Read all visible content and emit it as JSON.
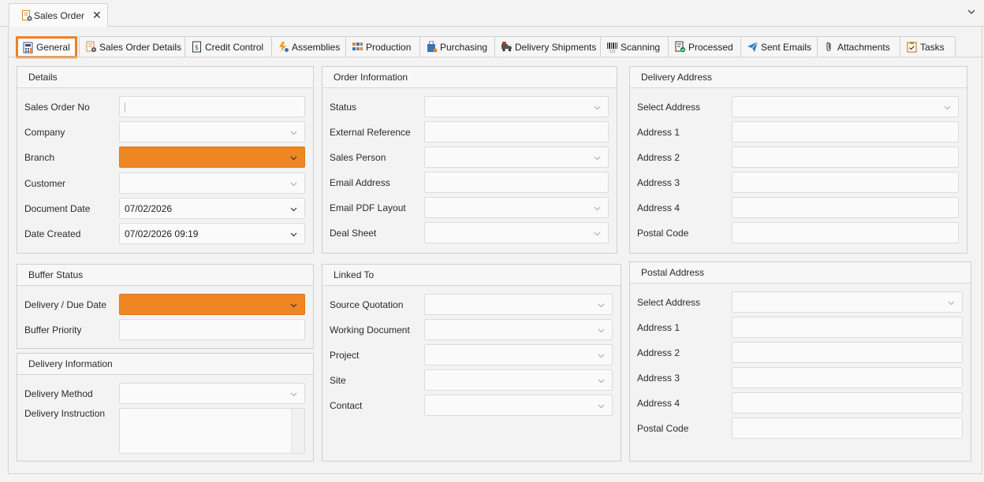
{
  "doc_tab": {
    "title": "Sales Order",
    "close": "✕"
  },
  "tabs": [
    {
      "label": "General",
      "icon": "calculator-icon"
    },
    {
      "label": "Sales Order Details",
      "icon": "document-gear-icon"
    },
    {
      "label": "Credit Control",
      "icon": "dollar-document-icon"
    },
    {
      "label": "Assemblies",
      "icon": "lightning-gear-icon"
    },
    {
      "label": "Production",
      "icon": "blocks-icon"
    },
    {
      "label": "Purchasing",
      "icon": "shopping-bag-icon"
    },
    {
      "label": "Delivery Shipments",
      "icon": "delivery-truck-icon"
    },
    {
      "label": "Scanning",
      "icon": "barcode-icon"
    },
    {
      "label": "Processed",
      "icon": "document-check-icon"
    },
    {
      "label": "Sent Emails",
      "icon": "paper-plane-icon"
    },
    {
      "label": "Attachments",
      "icon": "paperclip-icon"
    },
    {
      "label": "Tasks",
      "icon": "clipboard-check-icon"
    }
  ],
  "details": {
    "header": "Details",
    "labels": [
      "Sales Order No",
      "Company",
      "Branch",
      "Customer",
      "Document Date",
      "Date Created"
    ],
    "document_date": "07/02/2026",
    "date_created": "07/02/2026 09:19"
  },
  "order_info": {
    "header": "Order Information",
    "labels": [
      "Status",
      "External Reference",
      "Sales Person",
      "Email Address",
      "Email PDF Layout",
      "Deal Sheet"
    ]
  },
  "delivery_address": {
    "header": "Delivery Address",
    "labels": [
      "Select Address",
      "Address 1",
      "Address 2",
      "Address 3",
      "Address 4",
      "Postal Code"
    ]
  },
  "buffer_status": {
    "header": "Buffer Status",
    "labels": [
      "Delivery / Due Date",
      "Buffer Priority"
    ]
  },
  "linked_to": {
    "header": "Linked To",
    "labels": [
      "Source Quotation",
      "Working Document",
      "Project",
      "Site",
      "Contact"
    ]
  },
  "postal_address": {
    "header": "Postal Address",
    "labels": [
      "Select Address",
      "Address 1",
      "Address 2",
      "Address 3",
      "Address 4",
      "Postal Code"
    ]
  },
  "delivery_info": {
    "header": "Delivery Information",
    "labels": [
      "Delivery Method",
      "Delivery Instruction"
    ]
  },
  "colors": {
    "accent_orange": "#ee8624",
    "tab_active_border": "#e9822c"
  }
}
